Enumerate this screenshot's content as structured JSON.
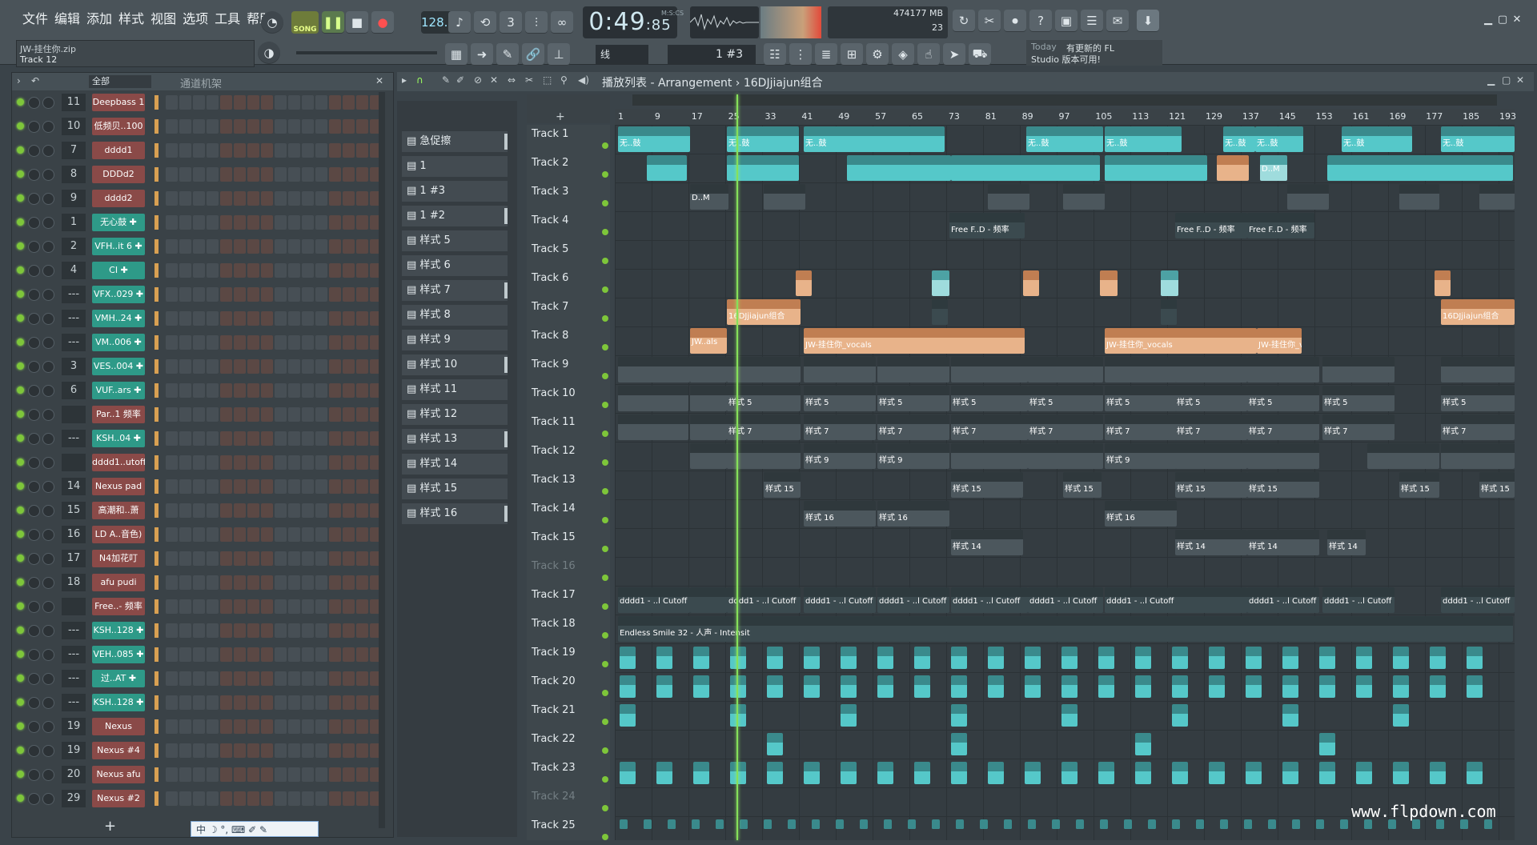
{
  "menu": [
    "文件",
    "编辑",
    "添加",
    "样式",
    "视图",
    "选项",
    "工具",
    "帮助"
  ],
  "transport": {
    "song": "SONG",
    "tempo": "128.000",
    "time_main": "0:49",
    "time_sub": "85",
    "time_unit": "M:S:CS"
  },
  "memory": {
    "cpu": "47",
    "mem": "4177 MB",
    "poly": "23"
  },
  "hint": {
    "title": "JW-挂住你.zip",
    "track": "Track 12"
  },
  "snap": "线",
  "pattern": "1 #3",
  "news": {
    "today": "Today",
    "msg": "有更新的 FL",
    "text": "Studio 版本可用!"
  },
  "rack": {
    "filter": "全部",
    "title": "通道机架",
    "channels": [
      {
        "num": "11",
        "name": "Deepbass 1",
        "color": "red"
      },
      {
        "num": "10",
        "name": "低频贝..100",
        "color": "red"
      },
      {
        "num": "7",
        "name": "dddd1",
        "color": "red"
      },
      {
        "num": "8",
        "name": "DDDd2",
        "color": "red"
      },
      {
        "num": "9",
        "name": "dddd2",
        "color": "red"
      },
      {
        "num": "1",
        "name": "无心鼓 ✚",
        "color": "green"
      },
      {
        "num": "2",
        "name": "VFH..it 6 ✚",
        "color": "green"
      },
      {
        "num": "4",
        "name": "CI ✚",
        "color": "green"
      },
      {
        "num": "---",
        "name": "VFX..029 ✚",
        "color": "green"
      },
      {
        "num": "---",
        "name": "VMH..24 ✚",
        "color": "green"
      },
      {
        "num": "---",
        "name": "VM..006 ✚",
        "color": "green"
      },
      {
        "num": "3",
        "name": "VES..004 ✚",
        "color": "green"
      },
      {
        "num": "6",
        "name": "VUF..ars ✚",
        "color": "green"
      },
      {
        "num": "",
        "name": "Par..1 频率",
        "color": "red"
      },
      {
        "num": "---",
        "name": "KSH..04 ✚",
        "color": "green"
      },
      {
        "num": "",
        "name": "dddd1..utoff",
        "color": "red"
      },
      {
        "num": "14",
        "name": "Nexus pad",
        "color": "red"
      },
      {
        "num": "15",
        "name": "高潮和..萧",
        "color": "red"
      },
      {
        "num": "16",
        "name": "LD A..音色)",
        "color": "red"
      },
      {
        "num": "17",
        "name": "N4加花叮",
        "color": "red"
      },
      {
        "num": "18",
        "name": "afu pudi",
        "color": "red"
      },
      {
        "num": "",
        "name": "Free..- 频率",
        "color": "red"
      },
      {
        "num": "---",
        "name": "KSH..128 ✚",
        "color": "green"
      },
      {
        "num": "---",
        "name": "VEH..085 ✚",
        "color": "green"
      },
      {
        "num": "---",
        "name": "过..AT ✚",
        "color": "green"
      },
      {
        "num": "---",
        "name": "KSH..128 ✚",
        "color": "green"
      },
      {
        "num": "19",
        "name": "Nexus",
        "color": "red"
      },
      {
        "num": "19",
        "name": "Nexus #4",
        "color": "red"
      },
      {
        "num": "20",
        "name": "Nexus afu",
        "color": "red"
      },
      {
        "num": "29",
        "name": "Nexus #2",
        "color": "red"
      }
    ]
  },
  "picker": [
    "急促擦",
    "1",
    "1 #3",
    "1 #2",
    "样式 5",
    "样式 6",
    "样式 7",
    "样式 8",
    "样式 9",
    "样式 10",
    "样式 11",
    "样式 12",
    "样式 13",
    "样式 14",
    "样式 15",
    "样式 16"
  ],
  "playlist": {
    "title": "播放列表 - Arrangement › 16DJjiajun组合",
    "ruler": [
      "1",
      "9",
      "17",
      "25",
      "33",
      "41",
      "49",
      "57",
      "65",
      "73",
      "81",
      "89",
      "97",
      "105",
      "113",
      "121",
      "129",
      "137",
      "145",
      "153",
      "161",
      "169",
      "177",
      "185",
      "193"
    ],
    "tracks": [
      "Track 1",
      "Track 2",
      "Track 3",
      "Track 4",
      "Track 5",
      "Track 6",
      "Track 7",
      "Track 8",
      "Track 9",
      "Track 10",
      "Track 11",
      "Track 12",
      "Track 13",
      "Track 14",
      "Track 15",
      "Track 16",
      "Track 17",
      "Track 18",
      "Track 19",
      "Track 20",
      "Track 21",
      "Track 22",
      "Track 23",
      "Track 24",
      "Track 25"
    ],
    "clip_labels": {
      "drum": "无..鼓",
      "dm": "D..M",
      "free": "Free F..D - 频率",
      "combo": "16DJjiajun组合",
      "vocal": "JW-挂住你_vocals",
      "jw": "JW..als",
      "cutoff": "dddd1 - ..l Cutoff",
      "endless": "Endless Smile 32 - 人声 - Intensit",
      "style5": "样式 5",
      "style7": "样式 7",
      "style9": "样式 9",
      "style15": "样式 15",
      "style16": "样式 16",
      "style14": "样式 14"
    }
  },
  "taskbar": "中 ☽ °, ⌨ ✐ ✎",
  "watermark": "www.flpdown.com"
}
